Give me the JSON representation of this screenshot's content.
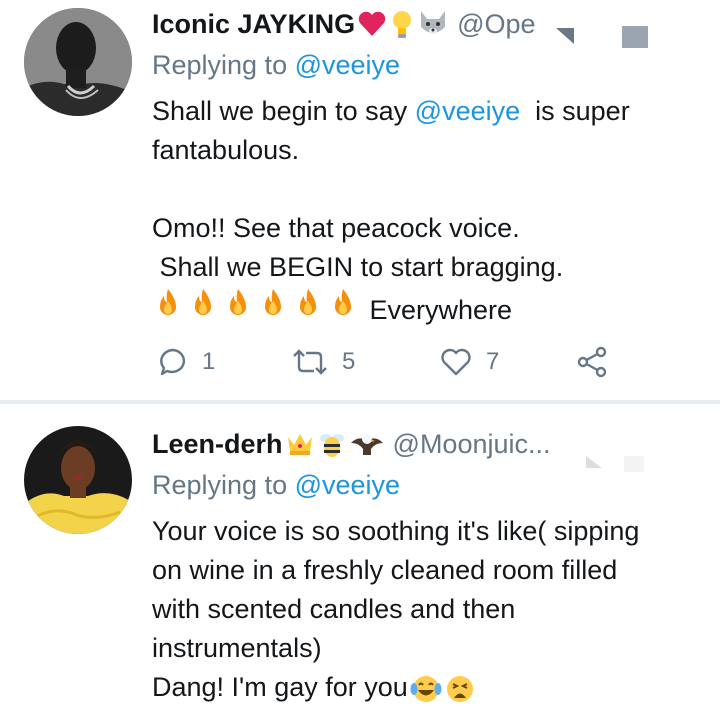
{
  "tweets": [
    {
      "display_name": "Iconic JAYKING",
      "handle": "@Ope",
      "replying_label": "Replying to",
      "replying_to": "@veeiye",
      "body_lines": [
        "Shall we begin to say ",
        "@veeiye",
        "  is super",
        "fantabulous.",
        "",
        "Omo!! See that peacock voice.",
        " Shall we BEGIN to start bragging.",
        " Everywhere"
      ],
      "emojis": [
        "red-heart-emoji",
        "light-bulb-emoji",
        "wolf-emoji"
      ],
      "actions": {
        "reply_count": "1",
        "retweet_count": "5",
        "like_count": "7"
      }
    },
    {
      "display_name": "Leen-derh",
      "handle": "@Moonjuic...",
      "replying_label": "Replying to",
      "replying_to": "@veeiye",
      "body_lines": [
        "Your voice is so soothing it's like( sipping",
        "on wine in a freshly cleaned room filled",
        "with scented candles and then",
        "instrumentals)",
        "Dang! I'm gay for you"
      ],
      "emojis": [
        "crown-emoji",
        "bee-emoji",
        "eagle-emoji",
        "tears-of-joy-emoji",
        "weary-face-emoji"
      ]
    }
  ],
  "colors": {
    "text": "#14171a",
    "secondary": "#657786",
    "link": "#1b95e0",
    "divider": "#e6ecf0"
  }
}
